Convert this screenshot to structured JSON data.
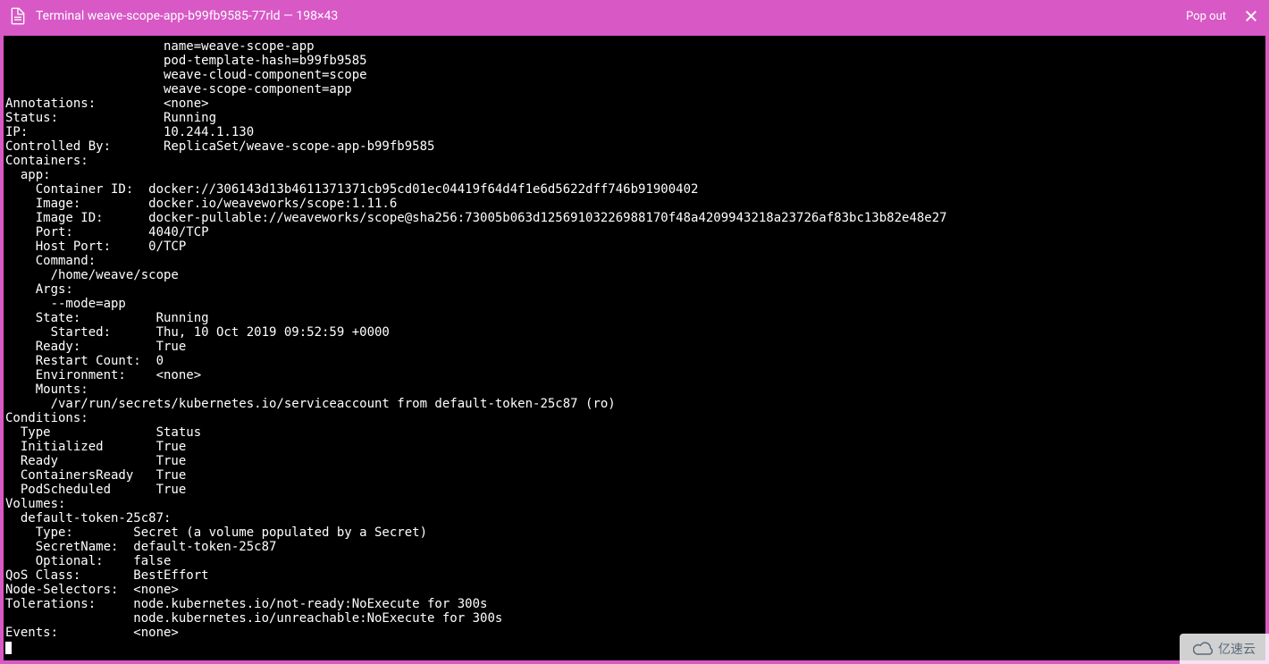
{
  "header": {
    "title": "Terminal weave-scope-app-b99fb9585-77rld — 198×43",
    "popout_label": "Pop out"
  },
  "watermark": {
    "text": "亿速云"
  },
  "terminal": {
    "lines": [
      "                     name=weave-scope-app",
      "                     pod-template-hash=b99fb9585",
      "                     weave-cloud-component=scope",
      "                     weave-scope-component=app",
      "Annotations:         <none>",
      "Status:              Running",
      "IP:                  10.244.1.130",
      "Controlled By:       ReplicaSet/weave-scope-app-b99fb9585",
      "Containers:",
      "  app:",
      "    Container ID:  docker://306143d13b4611371371cb95cd01ec04419f64d4f1e6d5622dff746b91900402",
      "    Image:         docker.io/weaveworks/scope:1.11.6",
      "    Image ID:      docker-pullable://weaveworks/scope@sha256:73005b063d12569103226988170f48a4209943218a23726af83bc13b82e48e27",
      "    Port:          4040/TCP",
      "    Host Port:     0/TCP",
      "    Command:",
      "      /home/weave/scope",
      "    Args:",
      "      --mode=app",
      "    State:          Running",
      "      Started:      Thu, 10 Oct 2019 09:52:59 +0000",
      "    Ready:          True",
      "    Restart Count:  0",
      "    Environment:    <none>",
      "    Mounts:",
      "      /var/run/secrets/kubernetes.io/serviceaccount from default-token-25c87 (ro)",
      "Conditions:",
      "  Type              Status",
      "  Initialized       True ",
      "  Ready             True ",
      "  ContainersReady   True ",
      "  PodScheduled      True ",
      "Volumes:",
      "  default-token-25c87:",
      "    Type:        Secret (a volume populated by a Secret)",
      "    SecretName:  default-token-25c87",
      "    Optional:    false",
      "QoS Class:       BestEffort",
      "Node-Selectors:  <none>",
      "Tolerations:     node.kubernetes.io/not-ready:NoExecute for 300s",
      "                 node.kubernetes.io/unreachable:NoExecute for 300s",
      "Events:          <none>"
    ]
  }
}
